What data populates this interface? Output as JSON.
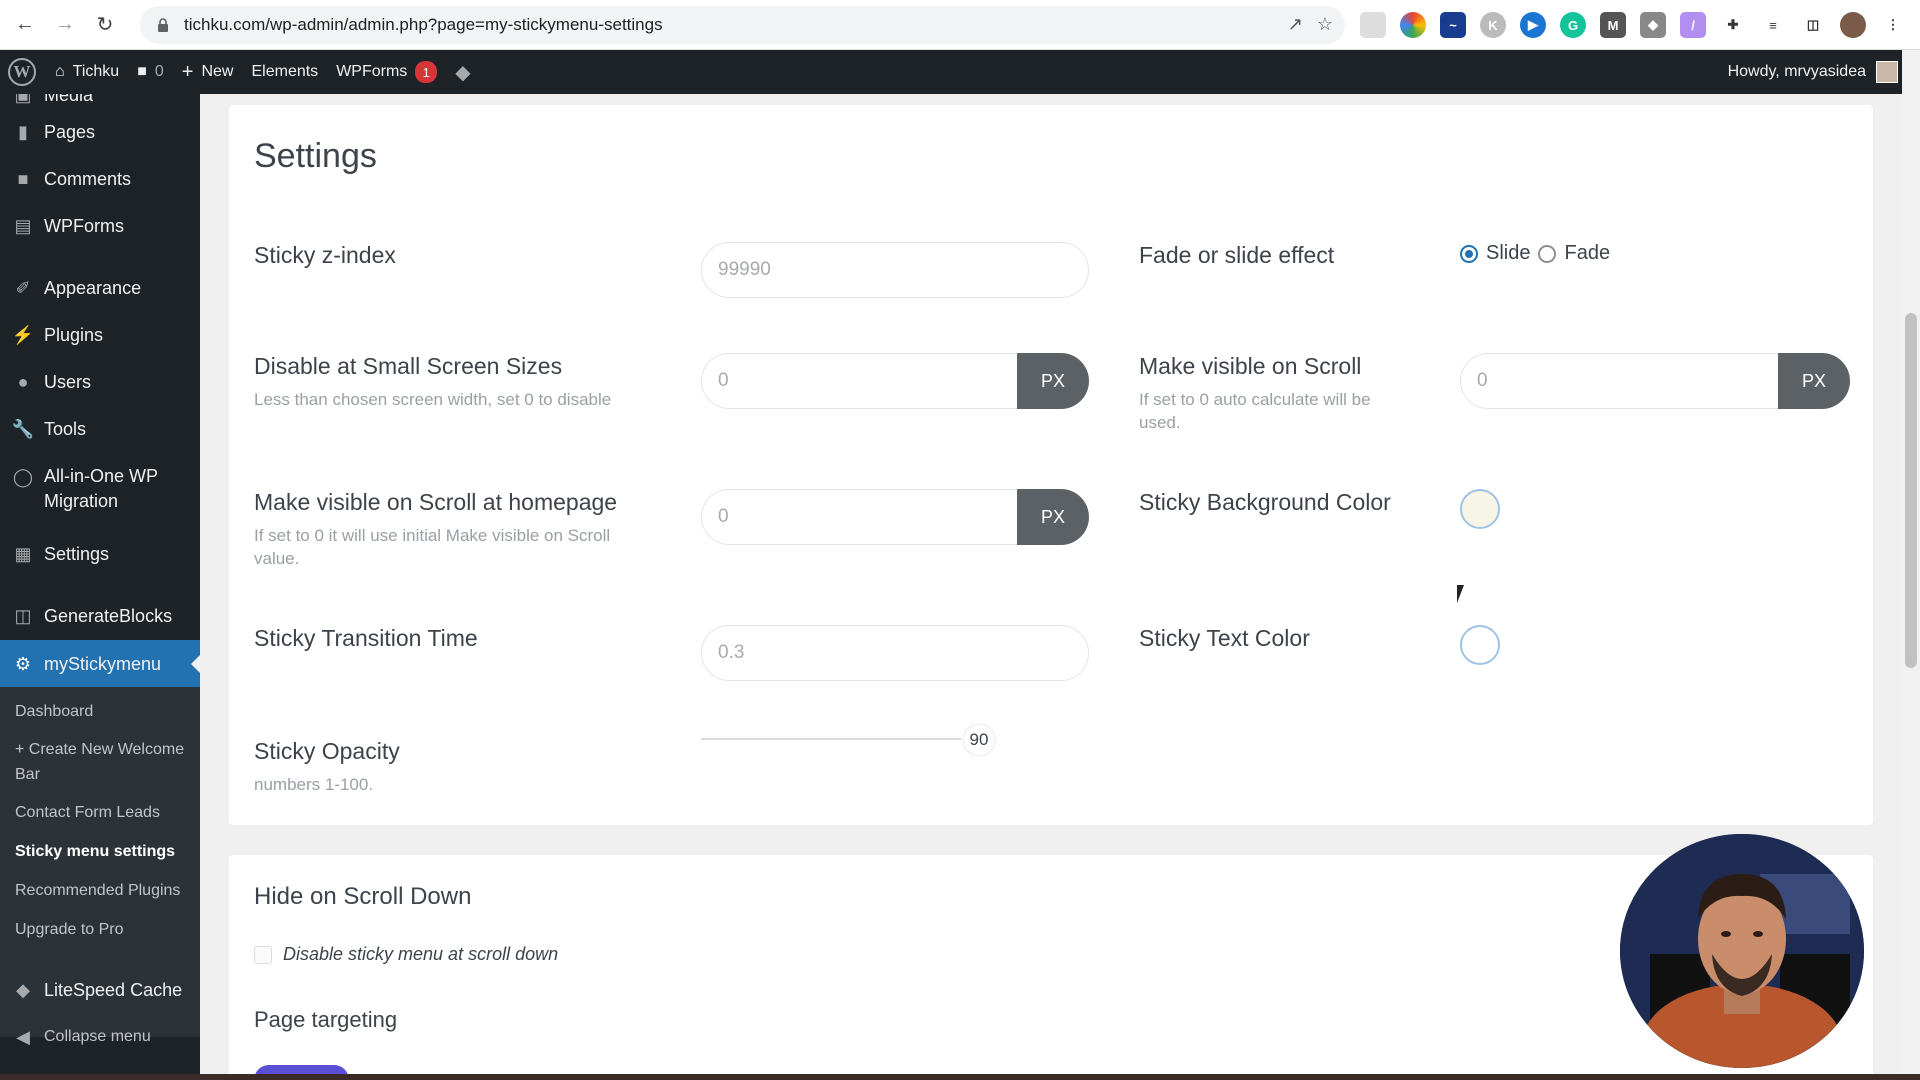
{
  "browser": {
    "url": "tichku.com/wp-admin/admin.php?page=my-stickymenu-settings"
  },
  "adminbar": {
    "site_name": "Tichku",
    "comments_count": "0",
    "new_label": "New",
    "elements_label": "Elements",
    "wpforms_label": "WPForms",
    "wpforms_badge": "1",
    "howdy": "Howdy, mrvyasidea"
  },
  "sidebar": {
    "items": [
      {
        "label": "Media",
        "icon": "media-icon"
      },
      {
        "label": "Pages",
        "icon": "pages-icon"
      },
      {
        "label": "Comments",
        "icon": "comments-icon"
      },
      {
        "label": "WPForms",
        "icon": "wpforms-icon"
      },
      {
        "label": "Appearance",
        "icon": "appearance-icon"
      },
      {
        "label": "Plugins",
        "icon": "plugins-icon"
      },
      {
        "label": "Users",
        "icon": "users-icon"
      },
      {
        "label": "Tools",
        "icon": "tools-icon"
      },
      {
        "label": "All-in-One WP Migration",
        "icon": "migration-icon"
      },
      {
        "label": "Settings",
        "icon": "settings-icon"
      },
      {
        "label": "GenerateBlocks",
        "icon": "generateblocks-icon"
      },
      {
        "label": "myStickymenu",
        "icon": "gear-icon"
      },
      {
        "label": "LiteSpeed Cache",
        "icon": "litespeed-icon"
      },
      {
        "label": "Collapse menu",
        "icon": "collapse-icon"
      }
    ],
    "submenu": [
      {
        "label": "Dashboard"
      },
      {
        "label": "+ Create New Welcome Bar"
      },
      {
        "label": "Contact Form Leads"
      },
      {
        "label": "Sticky menu settings"
      },
      {
        "label": "Recommended Plugins"
      },
      {
        "label": "Upgrade to Pro"
      }
    ]
  },
  "settings": {
    "heading": "Settings",
    "z_index": {
      "label": "Sticky z-index",
      "placeholder": "99990"
    },
    "fade_slide": {
      "label": "Fade or slide effect",
      "option_slide": "Slide",
      "option_fade": "Fade",
      "selected": "Slide"
    },
    "small_screen": {
      "label": "Disable at Small Screen Sizes",
      "hint": "Less than chosen screen width, set 0 to disable",
      "placeholder": "0",
      "unit": "PX"
    },
    "visible_scroll": {
      "label": "Make visible on Scroll",
      "hint": "If set to 0 auto calculate will be used.",
      "placeholder": "0",
      "unit": "PX"
    },
    "visible_home": {
      "label": "Make visible on Scroll at homepage",
      "hint": "If set to 0 it will use initial Make visible on Scroll value.",
      "placeholder": "0",
      "unit": "PX"
    },
    "bg_color": {
      "label": "Sticky Background Color",
      "value": "#f7f5e6"
    },
    "transition": {
      "label": "Sticky Transition Time",
      "placeholder": "0.3"
    },
    "text_color": {
      "label": "Sticky Text Color",
      "value": "#ffffff"
    },
    "opacity": {
      "label": "Sticky Opacity",
      "hint": "numbers 1-100.",
      "value": "90"
    }
  },
  "section2": {
    "heading": "Hide on Scroll Down",
    "checkbox_label": "Disable sticky menu at scroll down",
    "page_targeting": "Page targeting"
  },
  "colors": {
    "admin_dark": "#1d2327",
    "accent": "#2271b1",
    "px_button": "#5c6165"
  }
}
